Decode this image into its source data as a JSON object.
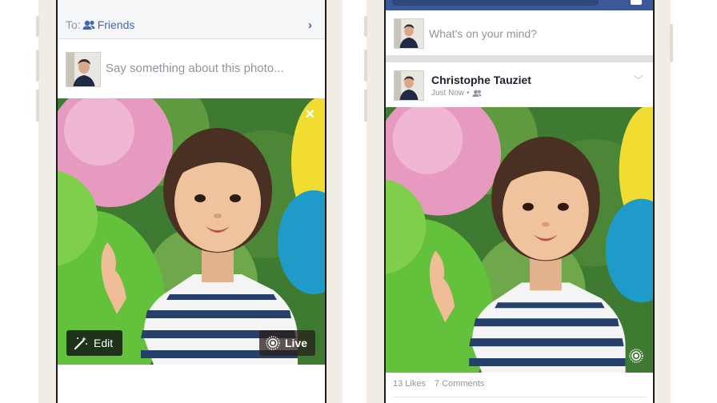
{
  "composer": {
    "to_label": "To:",
    "audience": "Friends",
    "placeholder": "Say something about this photo...",
    "edit_label": "Edit",
    "live_label": "Live"
  },
  "feed": {
    "mind_placeholder": "What's on your mind?",
    "post": {
      "author": "Christophe Tauziet",
      "time": "Just Now",
      "separator": "•",
      "likes": "13 Likes",
      "comments": "7 Comments"
    }
  },
  "icons": {
    "friends": "friends-icon",
    "close": "close-icon",
    "magic_wand": "magic-wand-icon",
    "live_photo": "live-photo-icon",
    "chevron_right": "chevron-right-icon",
    "chevron_down": "chevron-down-icon"
  },
  "colors": {
    "facebook_blue": "#3b5998",
    "link_blue": "#4267b2",
    "muted_gray": "#90949c"
  }
}
